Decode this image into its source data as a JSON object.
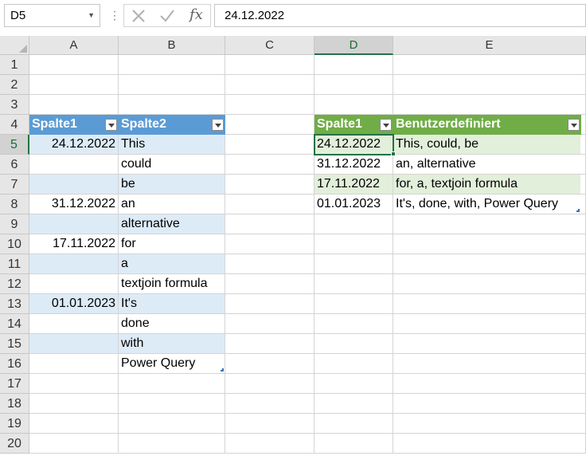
{
  "formula_bar": {
    "name_box": "D5",
    "formula": "24.12.2022",
    "fx_label": "fx"
  },
  "columns": [
    "A",
    "B",
    "C",
    "D",
    "E"
  ],
  "rows": [
    "1",
    "2",
    "3",
    "4",
    "5",
    "6",
    "7",
    "8",
    "9",
    "10",
    "11",
    "12",
    "13",
    "14",
    "15",
    "16",
    "17",
    "18",
    "19",
    "20"
  ],
  "selected_cell": "D5",
  "table1": {
    "header_color": "#5b9bd5",
    "band_color": "#ddebf7",
    "headers": [
      "Spalte1",
      "Spalte2"
    ],
    "rows": [
      [
        "24.12.2022",
        "This"
      ],
      [
        "",
        "could"
      ],
      [
        "",
        "be"
      ],
      [
        "31.12.2022",
        "an"
      ],
      [
        "",
        "alternative"
      ],
      [
        "17.11.2022",
        "for"
      ],
      [
        "",
        "a"
      ],
      [
        "",
        "textjoin formula"
      ],
      [
        "01.01.2023",
        "It's"
      ],
      [
        "",
        "done"
      ],
      [
        "",
        "with"
      ],
      [
        "",
        "Power Query"
      ]
    ]
  },
  "table2": {
    "header_color": "#70ad47",
    "band_color": "#e2efda",
    "headers": [
      "Spalte1",
      "Benutzerdefiniert"
    ],
    "rows": [
      [
        "24.12.2022",
        "This, could, be"
      ],
      [
        "31.12.2022",
        "an, alternative"
      ],
      [
        "17.11.2022",
        "for, a, textjoin formula"
      ],
      [
        "01.01.2023",
        "It's, done, with, Power Query"
      ]
    ]
  }
}
